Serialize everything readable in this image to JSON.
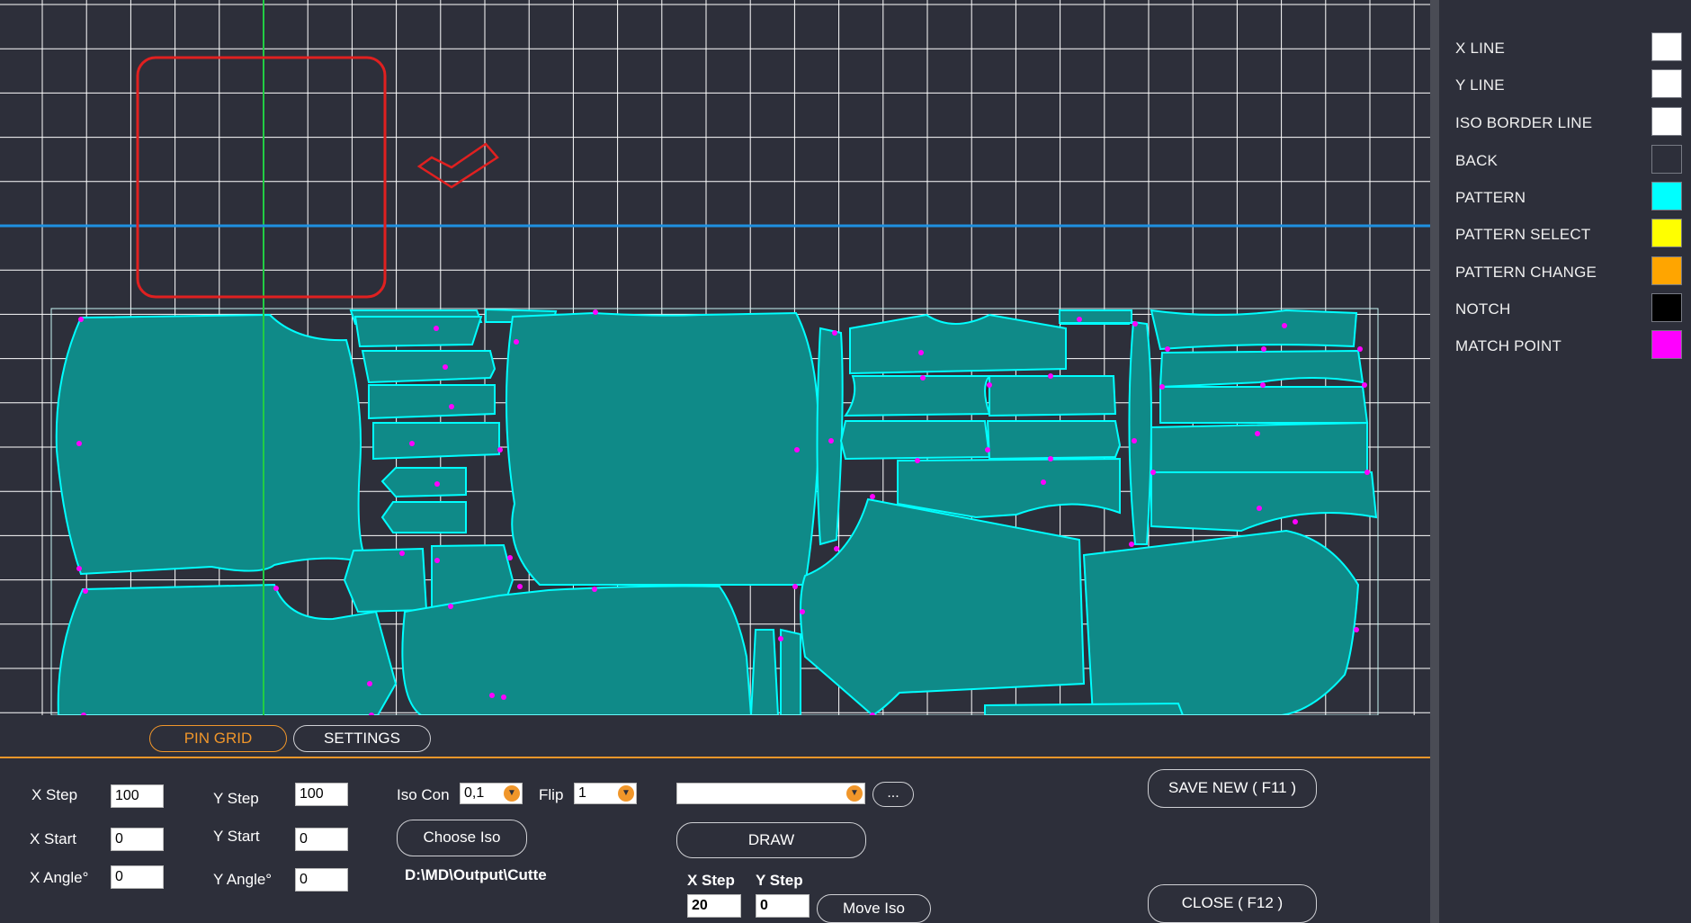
{
  "tabs": {
    "pin_grid": "PIN GRID",
    "settings": "SETTINGS"
  },
  "legend": [
    {
      "label": "X LINE",
      "color": "#ffffff"
    },
    {
      "label": "Y LINE",
      "color": "#ffffff"
    },
    {
      "label": "ISO BORDER LINE",
      "color": "#ffffff"
    },
    {
      "label": "BACK",
      "color": "#2d2f3a"
    },
    {
      "label": "PATTERN",
      "color": "#00ffff"
    },
    {
      "label": "PATTERN SELECT",
      "color": "#ffff00"
    },
    {
      "label": "PATTERN CHANGE",
      "color": "#ffa500"
    },
    {
      "label": "NOTCH",
      "color": "#000000"
    },
    {
      "label": "MATCH POINT",
      "color": "#ff00ff"
    }
  ],
  "grid": {
    "x_step_label": "X Step",
    "x_step": "100",
    "y_step_label": "Y Step",
    "y_step": "100",
    "x_start_label": "X Start",
    "x_start": "0",
    "y_start_label": "Y Start",
    "y_start": "0",
    "x_angle_label": "X Angle°",
    "x_angle": "0",
    "y_angle_label": "Y Angle°",
    "y_angle": "0"
  },
  "iso": {
    "iso_con_label": "Iso Con",
    "iso_con_value": "0,1",
    "flip_label": "Flip",
    "flip_value": "1",
    "choose_iso": "Choose Iso",
    "path": "D:\\MD\\Output\\Cutte",
    "combo_value": "",
    "browse": "..."
  },
  "draw": {
    "draw_label": "DRAW",
    "x_step_label": "X Step",
    "x_step": "20",
    "y_step_label": "Y Step",
    "y_step": "0",
    "move_iso": "Move Iso"
  },
  "actions": {
    "save_new": "SAVE NEW ( F11 )",
    "close": "CLOSE ( F12 )"
  },
  "colors": {
    "accent": "#f0962a",
    "pattern_fill": "#0f8a88",
    "pattern_stroke": "#00ffff",
    "grid": "#ffffff",
    "guide_v": "#22cc44",
    "guide_h": "#1e90e0",
    "marker": "#e02020",
    "match_point": "#ff00ff"
  },
  "icons": [
    "chevron-down-icon",
    "check-marker-icon",
    "square-marker-icon"
  ]
}
